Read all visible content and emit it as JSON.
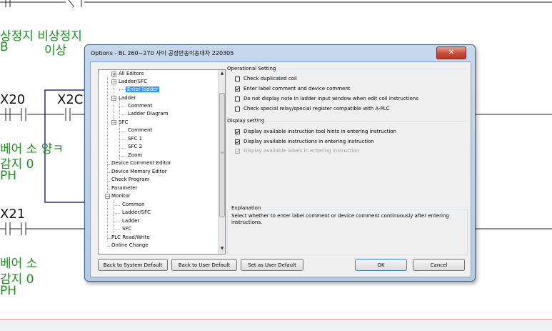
{
  "ladder": {
    "top_label_line1": "상정지 비상정지",
    "top_label_line2a": "B",
    "top_label_line2b": "이상",
    "contact1_name": "X20",
    "contact2_name": "X2C",
    "comment1_line1": "베어 소 양ㅋ",
    "comment1_line2": "감지 0",
    "comment1_line3": "PH",
    "contact3_name": "X21",
    "comment2_line1": "베어 소",
    "comment2_line2": "감지 0",
    "comment2_line3": "PH",
    "colors": {
      "comment": "#1f8f1f",
      "frame": "#2b2b8f"
    }
  },
  "dialog": {
    "title": "Options - BL 260~270 사이 공정반송이송대차 220305",
    "close_glyph": "✕",
    "tree": {
      "items": [
        {
          "label": "All Editors",
          "expander": "+"
        },
        {
          "label": "Ladder/SFC",
          "expander": "−"
        },
        {
          "label": "Enter ladder",
          "selected": true
        },
        {
          "label": "Ladder",
          "expander": "−"
        },
        {
          "label": "Comment"
        },
        {
          "label": "Ladder Diagram"
        },
        {
          "label": "SFC",
          "expander": "−"
        },
        {
          "label": "Comment"
        },
        {
          "label": "SFC 1"
        },
        {
          "label": "SFC 2"
        },
        {
          "label": "Zoom"
        },
        {
          "label": "Device Comment Editor"
        },
        {
          "label": "Device Memory Editor"
        },
        {
          "label": "Check Program"
        },
        {
          "label": "Parameter"
        },
        {
          "label": "Monitor",
          "expander": "−"
        },
        {
          "label": "Common"
        },
        {
          "label": "Ladder/SFC"
        },
        {
          "label": "Ladder"
        },
        {
          "label": "SFC"
        },
        {
          "label": "PLC Read/Write"
        },
        {
          "label": "Online Change"
        }
      ],
      "scroll_up": "▲",
      "scroll_down": "▼",
      "scroll_grip": "≡"
    },
    "operational_setting": {
      "label": "Operational Setting",
      "options": [
        {
          "label": "Check duplicated coil",
          "checked": false
        },
        {
          "label": "Enter label comment and device comment",
          "checked": true
        },
        {
          "label": "Do not display note in ladder input window when edit coil instructions",
          "checked": false
        },
        {
          "label": "Check special relay/special register compatible with A-PLC",
          "checked": false
        }
      ]
    },
    "display_setting": {
      "label": "Display setting",
      "options": [
        {
          "label": "Display available instruction tool hints in entering instruction",
          "checked": true,
          "disabled": false
        },
        {
          "label": "Display available instructions in entering instruction",
          "checked": true,
          "disabled": false
        },
        {
          "label": "Display available labels in entering instruction",
          "checked": true,
          "disabled": true
        }
      ]
    },
    "explanation": {
      "label": "Explanation",
      "text": "Select whether to enter label comment or device comment continuously after entering instructions."
    },
    "buttons": {
      "back_system": "Back to System Default",
      "back_user": "Back to User Default",
      "set_user": "Set as User Default",
      "ok": "OK",
      "cancel": "Cancel"
    },
    "check_glyph": "✔"
  }
}
